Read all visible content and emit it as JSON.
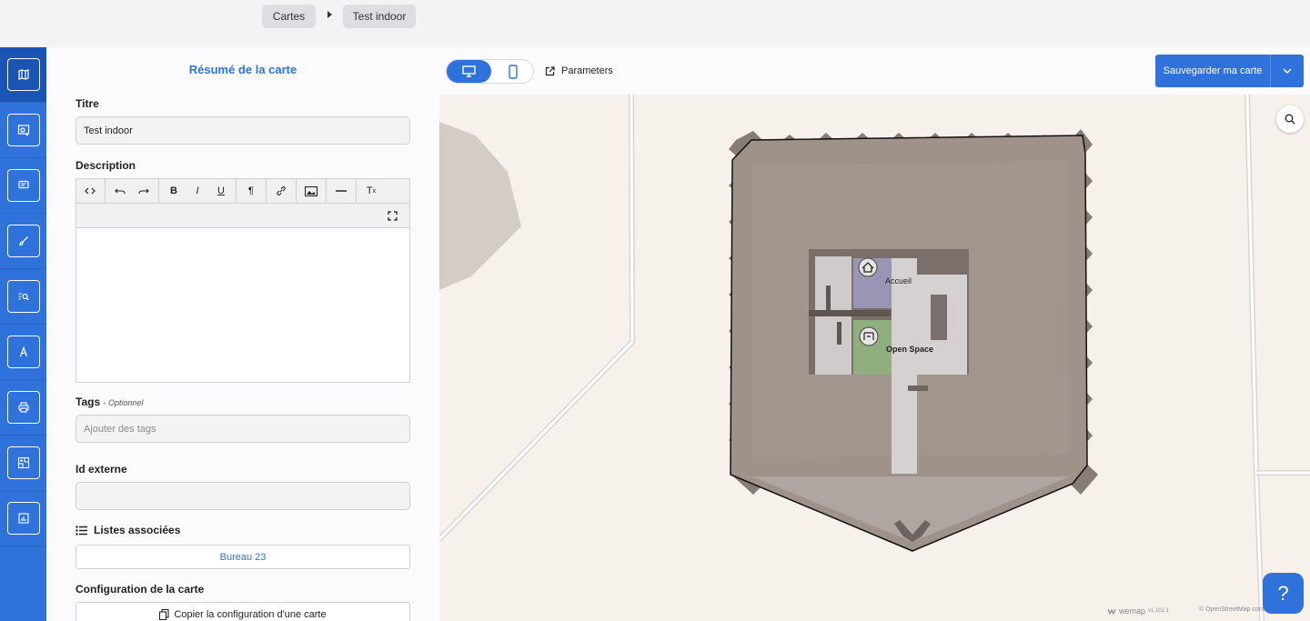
{
  "breadcrumb": {
    "root": "Cartes",
    "current": "Test indoor"
  },
  "sidebar": {
    "items": [
      {
        "icon": "map-icon"
      },
      {
        "icon": "map-settings-icon"
      },
      {
        "icon": "comment-icon"
      },
      {
        "icon": "brush-icon"
      },
      {
        "icon": "search-list-icon"
      },
      {
        "icon": "text-icon"
      },
      {
        "icon": "print-icon"
      },
      {
        "icon": "indoor-map-icon"
      },
      {
        "icon": "stats-icon"
      }
    ]
  },
  "panel": {
    "title": "Résumé de la carte",
    "title_label": "Titre",
    "title_value": "Test indoor",
    "description_label": "Description",
    "tags_label": "Tags",
    "tags_optional": "- Optionnel",
    "tags_placeholder": "Ajouter des tags",
    "external_id_label": "Id externe",
    "external_id_value": "",
    "lists_label": "Listes associées",
    "lists": [
      "Bureau 23"
    ],
    "config_label": "Configuration de la carte",
    "copy_config_label": "Copier la configuration d'une carte"
  },
  "editor_toolbar": [
    "code-icon",
    "undo-icon",
    "redo-icon",
    "bold-icon",
    "italic-icon",
    "underline-icon",
    "paragraph-icon",
    "link-icon",
    "image-icon",
    "horizontal-rule-icon",
    "clear-format-icon",
    "fullscreen-icon"
  ],
  "map_toolbar": {
    "device_selected": "desktop",
    "parameters_label": "Parameters",
    "save_label": "Sauvegarder ma carte"
  },
  "map": {
    "pois": [
      "Accueil",
      "Open Space"
    ],
    "brand": "wemap",
    "version": "v1.102.1",
    "attribution": "© OpenStreetMap contributors",
    "help_label": "?"
  },
  "colors": {
    "accent": "#2f72dc",
    "building": "#9e928b",
    "reception": "#9b95b5",
    "open_space": "#8fb07e"
  }
}
